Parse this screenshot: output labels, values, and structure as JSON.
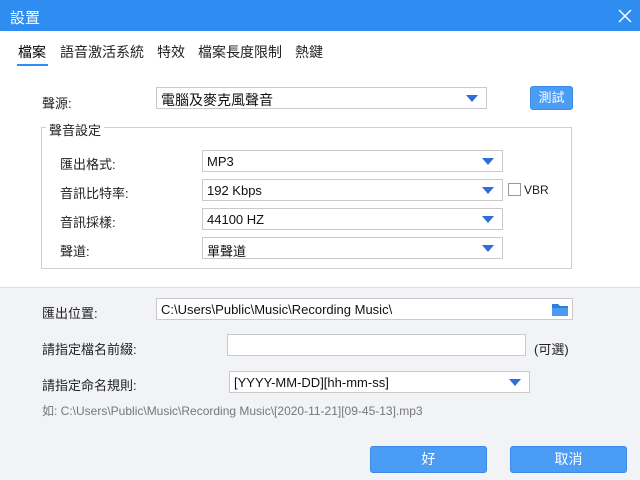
{
  "window": {
    "title": "設置",
    "close_label": "×"
  },
  "tabs": [
    {
      "label": "檔案",
      "active": true
    },
    {
      "label": "語音激活系統",
      "active": false
    },
    {
      "label": "特效",
      "active": false
    },
    {
      "label": "檔案長度限制",
      "active": false
    },
    {
      "label": "熱鍵",
      "active": false
    }
  ],
  "source": {
    "label": "聲源:",
    "value": "電腦及麥克風聲音",
    "test_button": "測試"
  },
  "audio_settings": {
    "title": "聲音設定",
    "format": {
      "label": "匯出格式:",
      "value": "MP3"
    },
    "bitrate": {
      "label": "音訊比特率:",
      "value": "192 Kbps",
      "vbr_label": "VBR",
      "vbr_checked": false
    },
    "sample_rate": {
      "label": "音訊採樣:",
      "value": "44100 HZ"
    },
    "channel": {
      "label": "聲道:",
      "value": "單聲道"
    }
  },
  "output": {
    "location_label": "匯出位置:",
    "location_value": "C:\\Users\\Public\\Music\\Recording Music\\",
    "prefix_label": "請指定檔名前綴:",
    "prefix_value": "",
    "prefix_optional": "(可選)",
    "naming_label": "請指定命名規則:",
    "naming_value": "[YYYY-MM-DD][hh-mm-ss]",
    "example_text": "如:   C:\\Users\\Public\\Music\\Recording Music\\[2020-11-21][09-45-13].mp3"
  },
  "footer": {
    "ok_button": "好",
    "cancel_button": "取消"
  },
  "colors": {
    "titlebar": "#2f8cf0",
    "button": "#4b9cf5",
    "arrow": "#2f6ed8",
    "lower_panel": "#f1f3f6"
  }
}
